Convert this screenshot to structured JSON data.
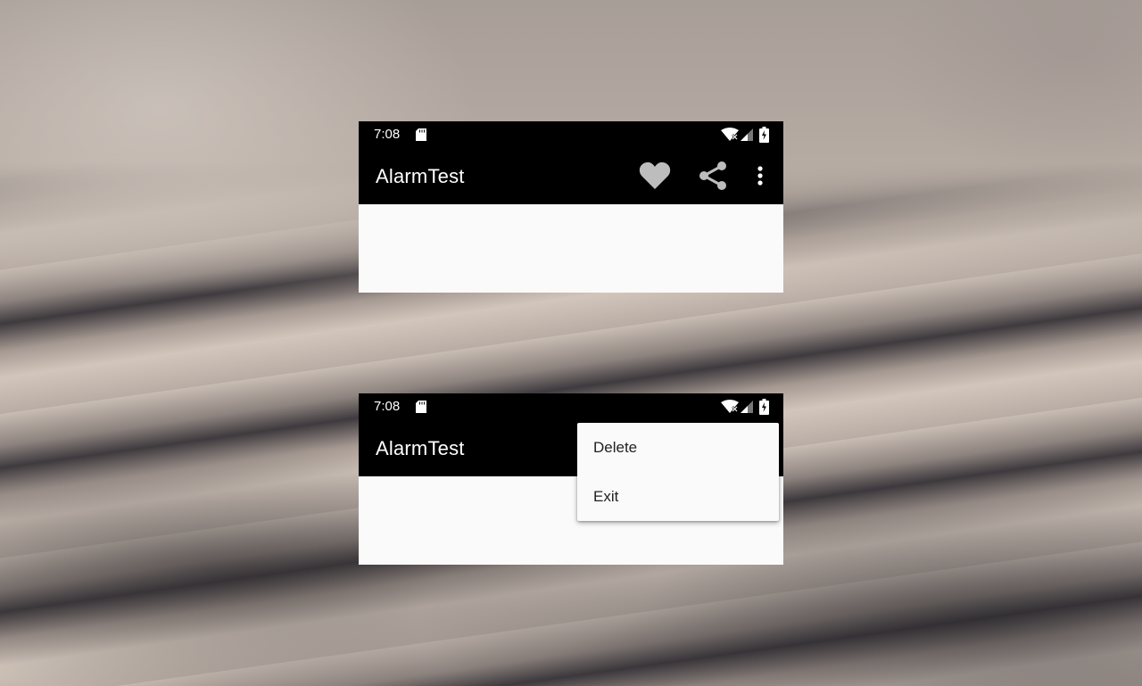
{
  "screens": [
    {
      "status": {
        "time": "7:08"
      },
      "toolbar": {
        "title": "AlarmTest",
        "actions": [
          "heart-icon",
          "share-icon",
          "more-vert-icon"
        ]
      }
    },
    {
      "status": {
        "time": "7:08"
      },
      "toolbar": {
        "title": "AlarmTest"
      },
      "overflow_menu": {
        "items": [
          {
            "label": "Delete"
          },
          {
            "label": "Exit"
          }
        ]
      }
    }
  ],
  "colors": {
    "toolbar": "#000000",
    "content": "#fafafa",
    "menu_background": "#fafafa",
    "icon": "#bdbdbd"
  }
}
